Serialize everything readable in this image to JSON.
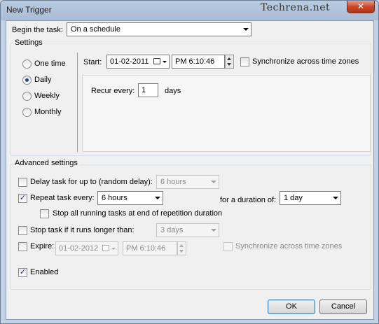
{
  "window": {
    "title": "New Trigger",
    "close_glyph": "✕",
    "watermark": "Techrena.net"
  },
  "begin_task": {
    "label": "Begin the task:",
    "value": "On a schedule"
  },
  "settings": {
    "title": "Settings",
    "radios": [
      {
        "label": "One time",
        "checked": false
      },
      {
        "label": "Daily",
        "checked": true
      },
      {
        "label": "Weekly",
        "checked": false
      },
      {
        "label": "Monthly",
        "checked": false
      }
    ],
    "start_label": "Start:",
    "start_date": "01-02-2011",
    "start_time": "PM  6:10:46",
    "sync_label": "Synchronize across time zones",
    "recur_label": "Recur every:",
    "recur_value": "1",
    "recur_unit": "days"
  },
  "advanced": {
    "title": "Advanced settings",
    "delay_label": "Delay task for up to (random delay):",
    "delay_value": "6 hours",
    "repeat_label": "Repeat task every:",
    "repeat_value": "6 hours",
    "duration_label": "for a duration of:",
    "duration_value": "1 day",
    "stop_all_label": "Stop all running tasks at end of repetition duration",
    "stop_longer_label": "Stop task if it runs longer than:",
    "stop_longer_value": "3 days",
    "expire_label": "Expire:",
    "expire_date": "01-02-2012",
    "expire_time": "PM  6:10:46",
    "expire_sync_label": "Synchronize across time zones",
    "enabled_label": "Enabled",
    "check_glyph": "✓"
  },
  "buttons": {
    "ok": "OK",
    "cancel": "Cancel"
  }
}
